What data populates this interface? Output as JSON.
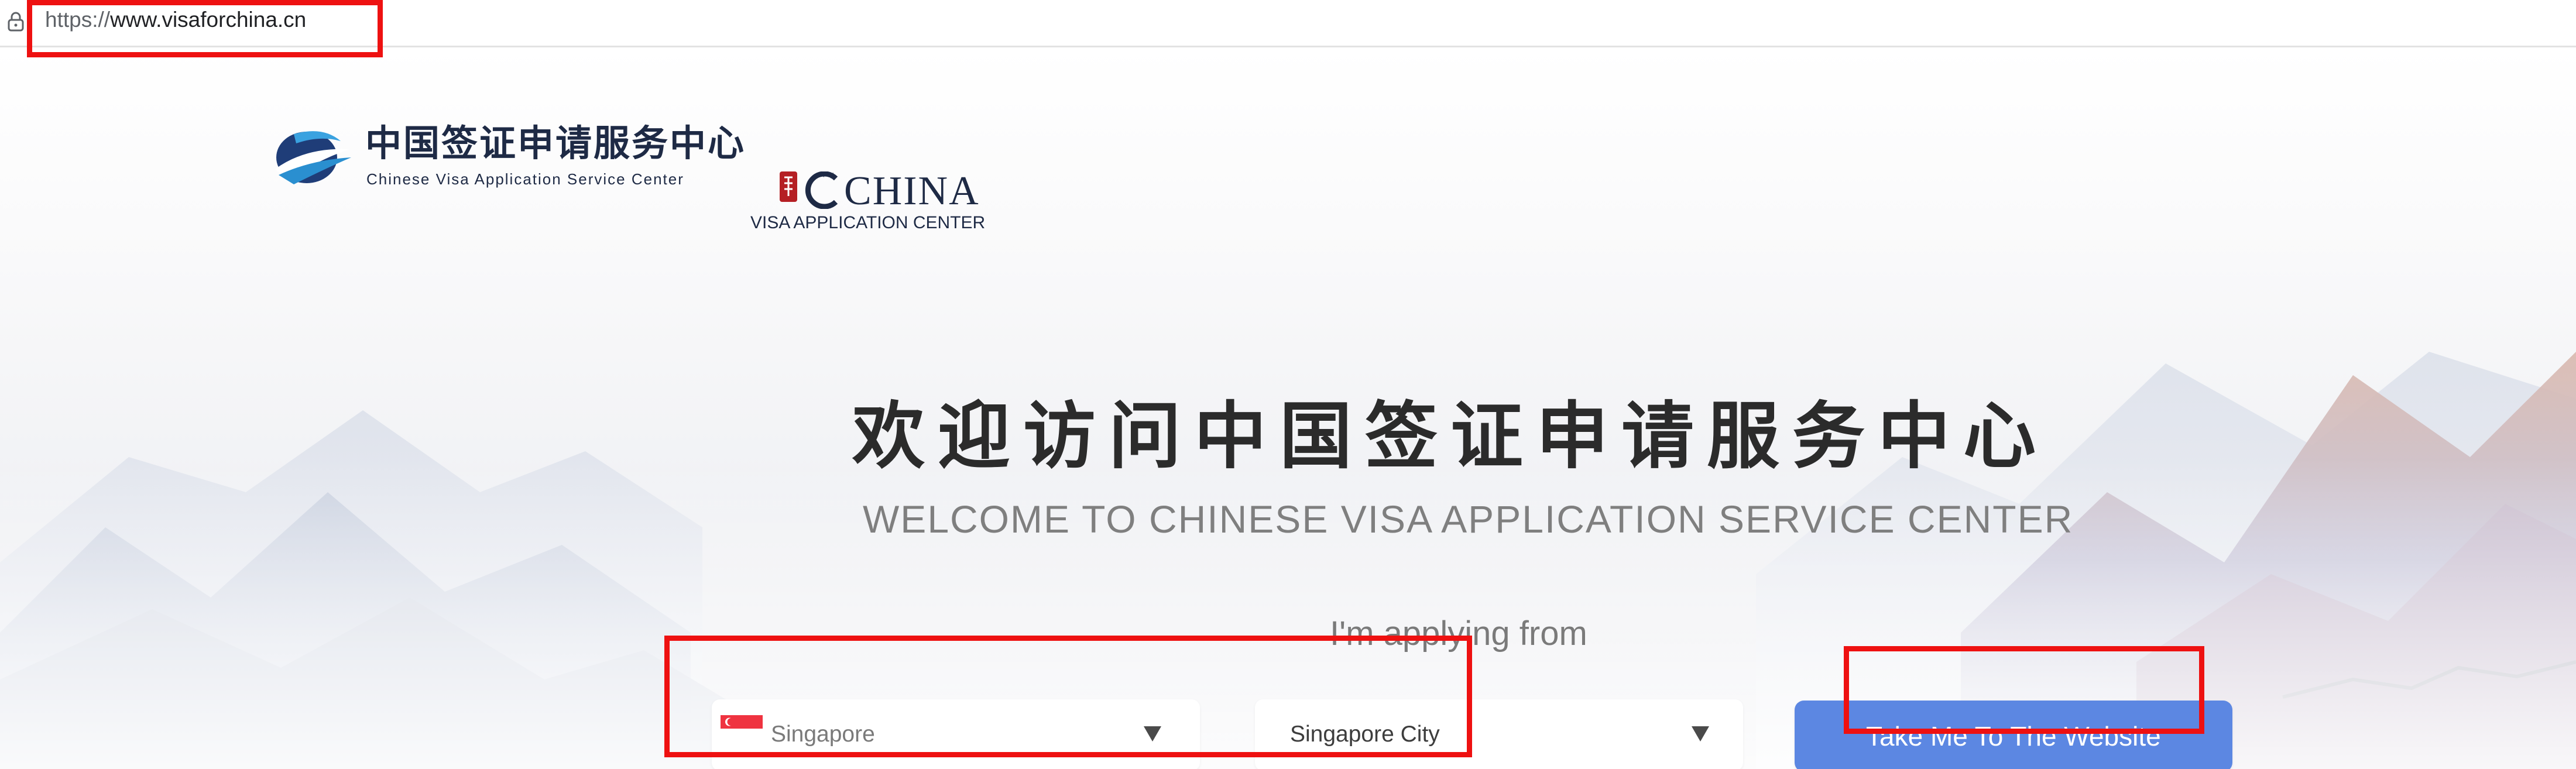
{
  "browser": {
    "url_scheme": "https://",
    "url_host": "www.visaforchina.cn",
    "lock_icon": "lock-icon"
  },
  "logos": {
    "cvasc_cn": "中国签证申请服务中心",
    "cvasc_en": "Chinese Visa Application Service Center",
    "china_word": "CHINA",
    "china_sub": "VISA APPLICATION CENTER"
  },
  "hero": {
    "welcome_cn": "欢迎访问中国签证申请服务中心",
    "welcome_en": "WELCOME TO CHINESE VISA APPLICATION SERVICE CENTER",
    "applying_from": "I'm applying from"
  },
  "form": {
    "country": {
      "value": "Singapore",
      "flag_icon": "singapore-flag-icon"
    },
    "city": {
      "value": "Singapore City"
    },
    "dropdown_icon": "chevron-down-icon",
    "submit_label": "Take Me To The Website"
  },
  "colors": {
    "button": "#5c87e2",
    "annotation": "#ee1111",
    "heading": "#2b2b2b",
    "subheading": "#7f7f7f",
    "logo_navy": "#1e2a45"
  }
}
